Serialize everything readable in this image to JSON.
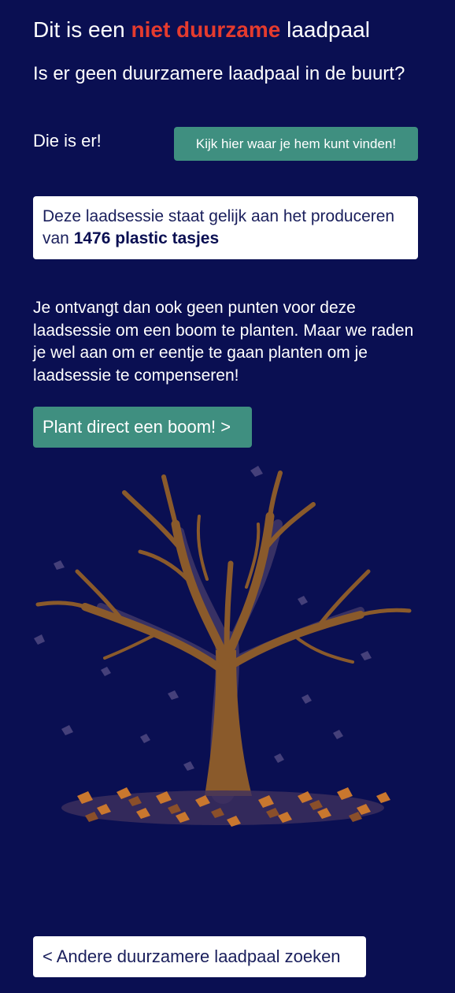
{
  "header": {
    "title_prefix": "Dit is een",
    "title_highlight": "niet duurzame",
    "title_suffix": "laadpaal",
    "highlight_color": "#e53b2e"
  },
  "alternative": {
    "question": "Is er geen duurzamere laadpaal in de buurt?",
    "answer": "Die is er!",
    "find_button_label": "Kijk hier waar je hem kunt vinden!"
  },
  "impact": {
    "text_prefix": "Deze laadsessie staat gelijk aan het produceren van",
    "amount": "1476 plastic tasjes"
  },
  "message": "Je ontvangt dan ook geen punten voor deze laadsessie om een boom te planten. Maar we raden je wel aan om er eentje te gaan planten om je laadsessie te compenseren!",
  "plant_button_label": "Plant direct een boom! >",
  "illustration": {
    "icon": "bare-tree-icon",
    "trunk_color": "#8a5a2b",
    "leaf_color": "#c9772e"
  },
  "back_button_label": "< Andere duurzamere laadpaal zoeken",
  "colors": {
    "background": "#0a0f52",
    "accent_button": "#3f8f80",
    "text": "#ffffff"
  }
}
